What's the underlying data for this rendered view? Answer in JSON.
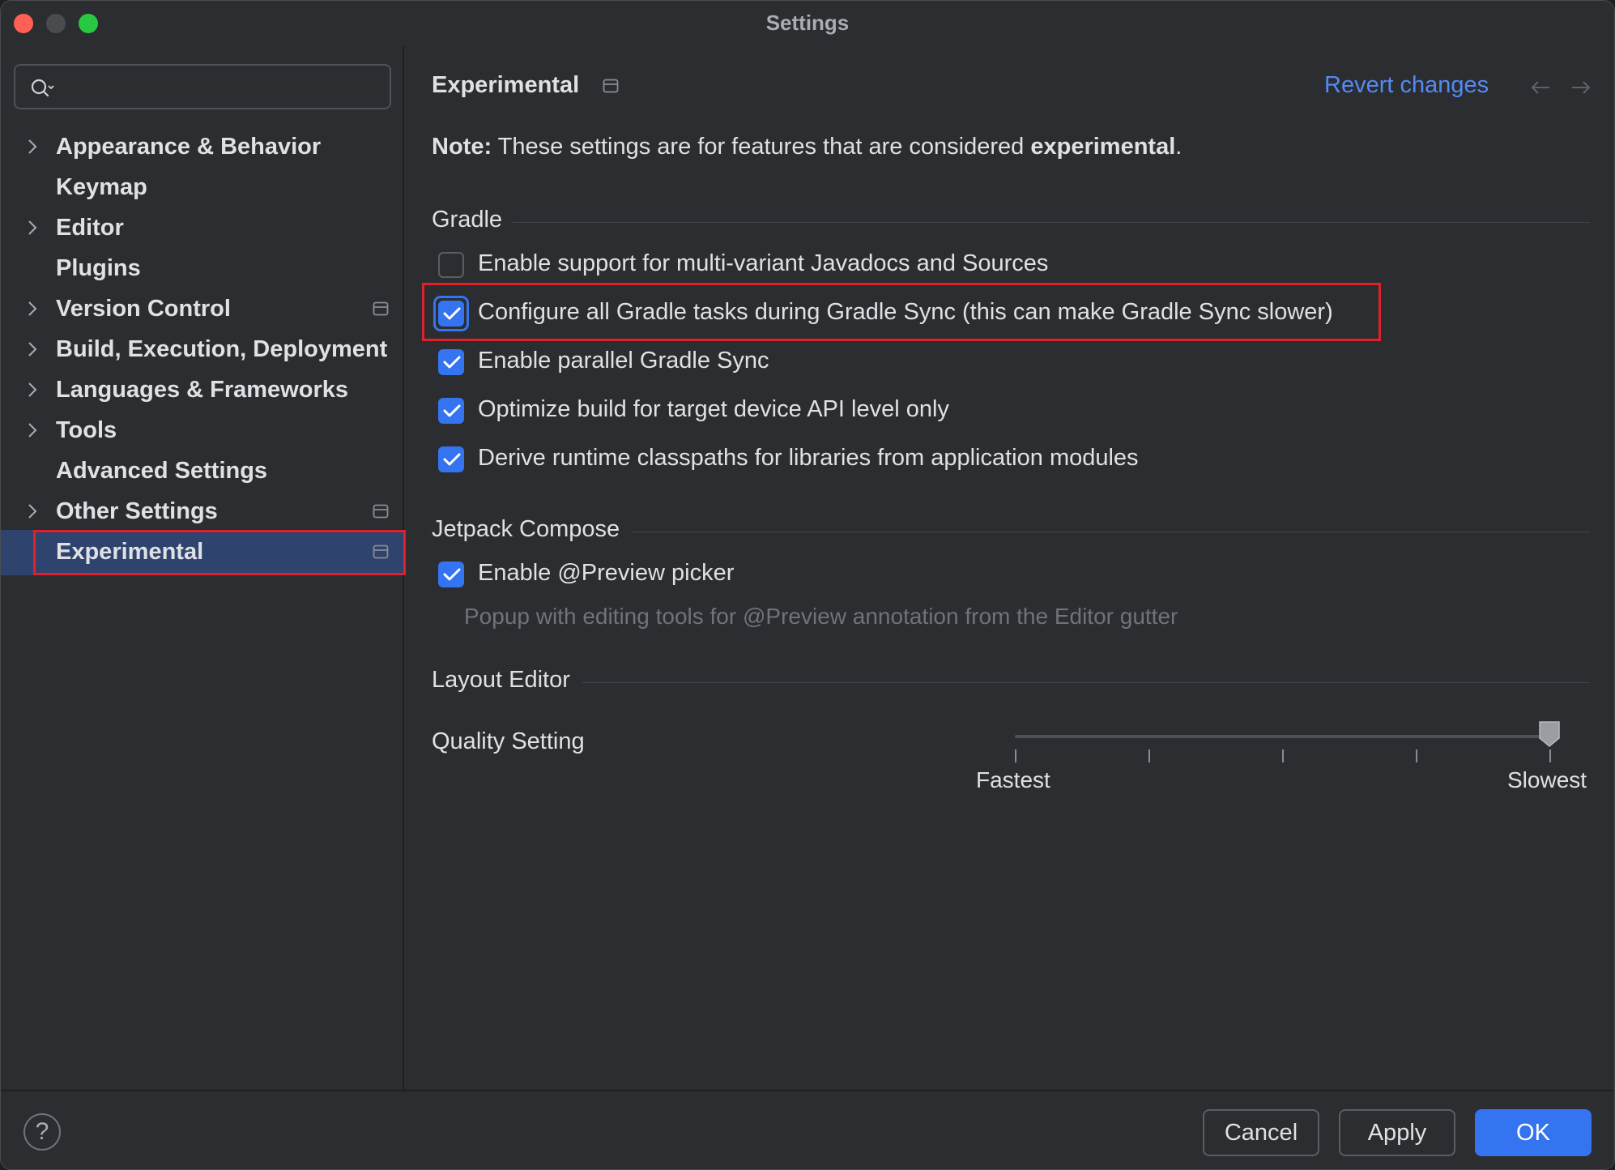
{
  "window": {
    "title": "Settings"
  },
  "search": {
    "placeholder": ""
  },
  "sidebar": {
    "items": [
      {
        "label": "Appearance & Behavior",
        "expandable": true,
        "project_icon": false
      },
      {
        "label": "Keymap",
        "expandable": false,
        "project_icon": false
      },
      {
        "label": "Editor",
        "expandable": true,
        "project_icon": false
      },
      {
        "label": "Plugins",
        "expandable": false,
        "project_icon": false
      },
      {
        "label": "Version Control",
        "expandable": true,
        "project_icon": true
      },
      {
        "label": "Build, Execution, Deployment",
        "expandable": true,
        "project_icon": false
      },
      {
        "label": "Languages & Frameworks",
        "expandable": true,
        "project_icon": false
      },
      {
        "label": "Tools",
        "expandable": true,
        "project_icon": false
      },
      {
        "label": "Advanced Settings",
        "expandable": false,
        "project_icon": false
      },
      {
        "label": "Other Settings",
        "expandable": true,
        "project_icon": true
      },
      {
        "label": "Experimental",
        "expandable": false,
        "project_icon": true,
        "selected": true
      }
    ]
  },
  "main": {
    "title": "Experimental",
    "revert_label": "Revert changes",
    "note": {
      "prefix": "Note:",
      "text": " These settings are for features that are considered ",
      "emph": "experimental",
      "suffix": "."
    },
    "gradle": {
      "title": "Gradle",
      "options": [
        {
          "label": "Enable support for multi-variant Javadocs and Sources",
          "checked": false
        },
        {
          "label": "Configure all Gradle tasks during Gradle Sync (this can make Gradle Sync slower)",
          "checked": true
        },
        {
          "label": "Enable parallel Gradle Sync",
          "checked": true
        },
        {
          "label": "Optimize build for target device API level only",
          "checked": true
        },
        {
          "label": "Derive runtime classpaths for libraries from application modules",
          "checked": true
        }
      ]
    },
    "compose": {
      "title": "Jetpack Compose",
      "option": {
        "label": "Enable @Preview picker",
        "checked": true
      },
      "hint": "Popup with editing tools for @Preview annotation from the Editor gutter"
    },
    "layout_editor": {
      "title": "Layout Editor",
      "quality_label": "Quality Setting",
      "slider_min_label": "Fastest",
      "slider_max_label": "Slowest",
      "slider_steps": 5,
      "slider_value_index": 4.5
    }
  },
  "footer": {
    "help": "?",
    "cancel": "Cancel",
    "apply": "Apply",
    "ok": "OK"
  },
  "colors": {
    "accent": "#3574f0",
    "link": "#548af7",
    "selection": "#2e436e",
    "highlight": "#e0202a"
  }
}
